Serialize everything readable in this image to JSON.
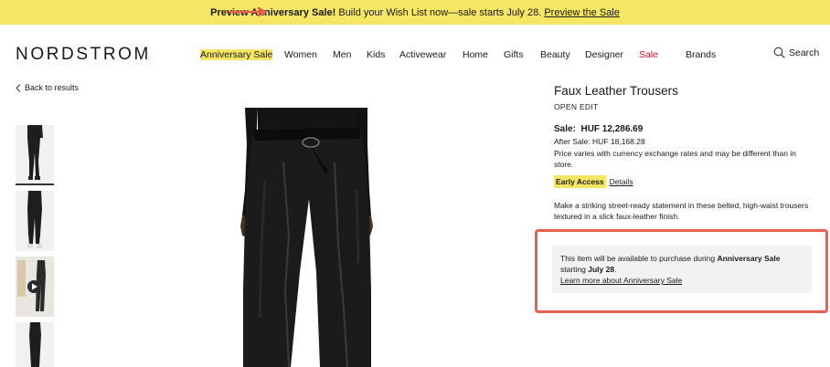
{
  "promo": {
    "bold": "Preview Anniversary Sale!",
    "text": " Build your Wish List now—sale starts July 28. ",
    "link": "Preview the Sale"
  },
  "header": {
    "logo": "NORDSTROM",
    "nav": [
      "Anniversary Sale",
      "Women",
      "Men",
      "Kids",
      "Activewear",
      "Home",
      "Gifts",
      "Beauty",
      "Designer",
      "Sale",
      "Brands"
    ],
    "search_label": "Search"
  },
  "back_link": "Back to results",
  "product": {
    "title": "Faux Leather Trousers",
    "brand": "OPEN EDIT",
    "sale_label": "Sale:",
    "sale_price": "HUF 12,286.69",
    "after_sale": "After Sale: HUF 18,168.28",
    "price_note": "Price varies with currency exchange rates and may be different than in store.",
    "early_access": "Early Access",
    "details_link": "Details",
    "description": "Make a striking street-ready statement in these belted, high-waist trousers textured in a slick faux-leather finish."
  },
  "availability": {
    "text1": "This item will be available to purchase during ",
    "bold1": "Anniversary Sale",
    "text2": " starting ",
    "bold2": "July 28",
    "text3": ".",
    "link": "Learn more about Anniversary Sale"
  },
  "colors": {
    "yellow": "#f5e663",
    "red": "#c8102e",
    "annotation": "#e8604f"
  }
}
